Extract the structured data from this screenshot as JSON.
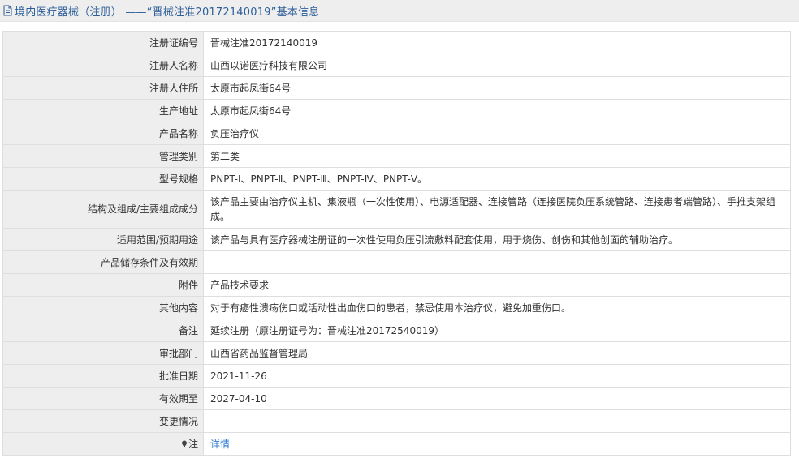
{
  "header": {
    "icon": "document-icon",
    "title": "境内医疗器械（注册） ——“晋械注准20172140019”基本信息"
  },
  "rows": [
    {
      "label": "注册证编号",
      "value": "晋械注准20172140019"
    },
    {
      "label": "注册人名称",
      "value": "山西以诺医疗科技有限公司"
    },
    {
      "label": "注册人住所",
      "value": "太原市起凤街64号"
    },
    {
      "label": "生产地址",
      "value": "太原市起凤街64号"
    },
    {
      "label": "产品名称",
      "value": "负压治疗仪"
    },
    {
      "label": "管理类别",
      "value": "第二类"
    },
    {
      "label": "型号规格",
      "value": "PNPT-Ⅰ、PNPT-Ⅱ、PNPT-Ⅲ、PNPT-Ⅳ、PNPT-Ⅴ。"
    },
    {
      "label": "结构及组成/主要组成成分",
      "value": "该产品主要由治疗仪主机、集液瓶（一次性使用）、电源适配器、连接管路（连接医院负压系统管路、连接患者端管路）、手推支架组成。"
    },
    {
      "label": "适用范围/预期用途",
      "value": "该产品与具有医疗器械注册证的一次性使用负压引流敷料配套使用，用于烧伤、创伤和其他创面的辅助治疗。"
    },
    {
      "label": "产品储存条件及有效期",
      "value": ""
    },
    {
      "label": "附件",
      "value": "产品技术要求"
    },
    {
      "label": "其他内容",
      "value": "对于有癌性溃疡伤口或活动性出血伤口的患者，禁忌使用本治疗仪，避免加重伤口。"
    },
    {
      "label": "备注",
      "value": "延续注册（原注册证号为：晋械注准20172540019）"
    },
    {
      "label": "审批部门",
      "value": "山西省药品监督管理局"
    },
    {
      "label": "批准日期",
      "value": "2021-11-26"
    },
    {
      "label": "有效期至",
      "value": "2027-04-10"
    },
    {
      "label": "变更情况",
      "value": ""
    }
  ],
  "note": {
    "icon": "pin-icon",
    "label": "注",
    "link_text": "详情",
    "link_color": "#2f7bd1"
  },
  "colors": {
    "title": "#2e5f9a",
    "label_bg": "#eeeeee",
    "border": "#dedede"
  }
}
